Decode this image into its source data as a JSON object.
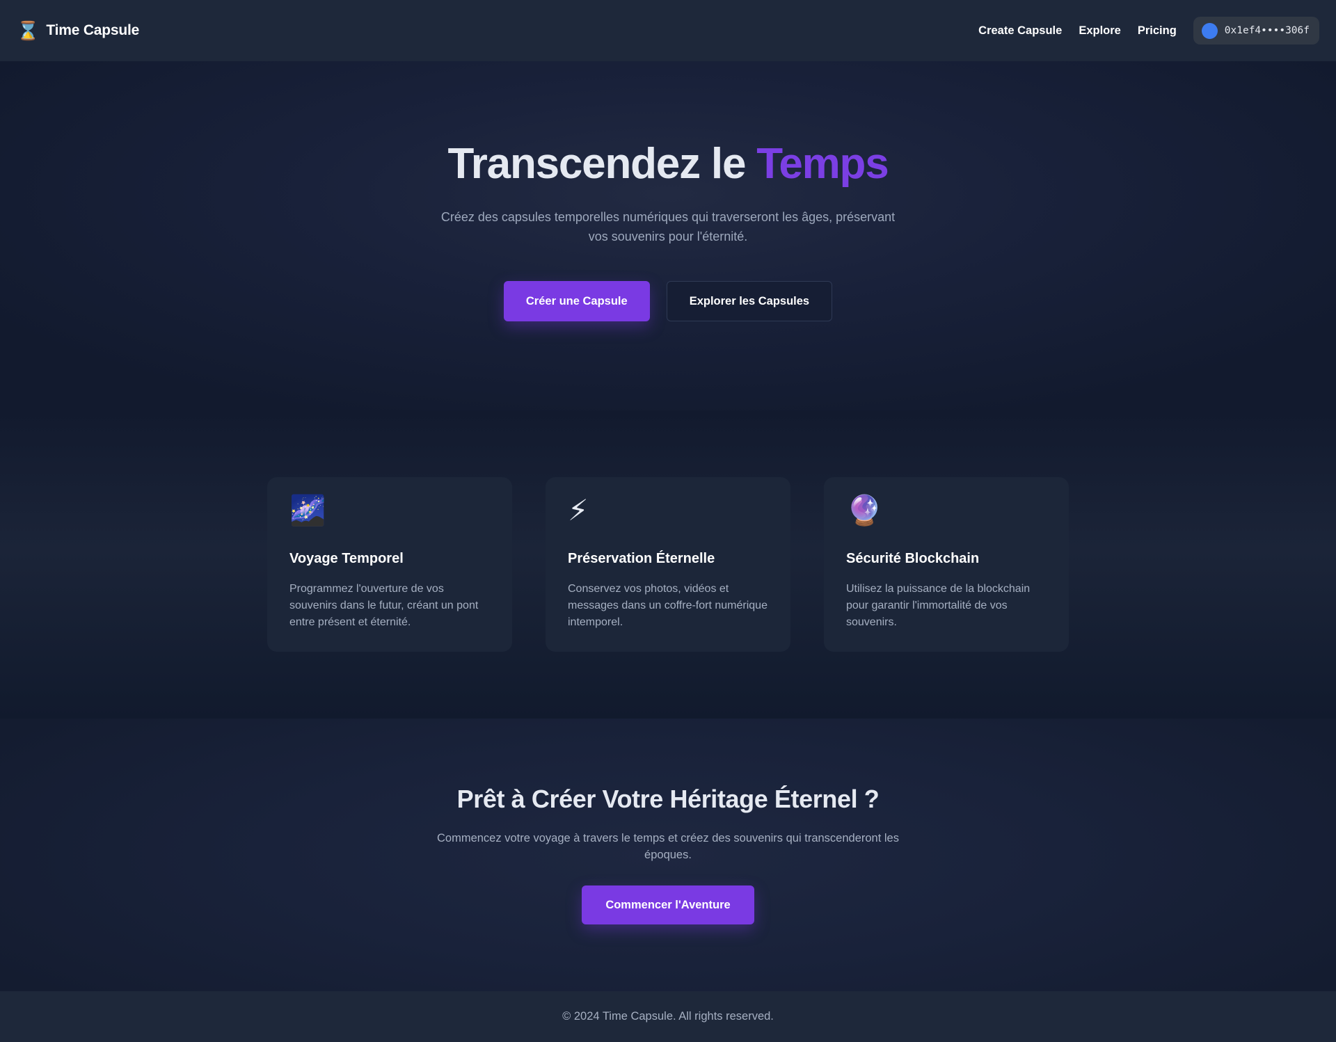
{
  "navbar": {
    "brand_icon": "⌛",
    "brand_title": "Time Capsule",
    "links": [
      "Create Capsule",
      "Explore",
      "Pricing"
    ],
    "wallet_address": "0x1ef4••••306f"
  },
  "hero": {
    "title_main": "Transcendez le",
    "title_accent": "Temps",
    "subtitle": "Créez des capsules temporelles numériques qui traverseront les âges, préservant vos souvenirs pour l'éternité.",
    "primary_button": "Créer une Capsule",
    "secondary_button": "Explorer les Capsules"
  },
  "features": [
    {
      "icon": "🌌",
      "icon_name": "milky-way-icon",
      "title": "Voyage Temporel",
      "description": "Programmez l'ouverture de vos souvenirs dans le futur, créant un pont entre présent et éternité."
    },
    {
      "icon": "⚡",
      "icon_name": "lightning-icon",
      "title": "Préservation Éternelle",
      "description": "Conservez vos photos, vidéos et messages dans un coffre-fort numérique intemporel."
    },
    {
      "icon": "🔮",
      "icon_name": "crystal-ball-icon",
      "title": "Sécurité Blockchain",
      "description": "Utilisez la puissance de la blockchain pour garantir l'immortalité de vos souvenirs."
    }
  ],
  "cta": {
    "title": "Prêt à Créer Votre Héritage Éternel ?",
    "subtitle": "Commencez votre voyage à travers le temps et créez des souvenirs qui transcenderont les époques.",
    "button": "Commencer l'Aventure"
  },
  "footer": {
    "copyright": "© 2024 Time Capsule. All rights reserved."
  },
  "colors": {
    "accent": "#7a3ae3",
    "title_accent": "#7b3fe4",
    "wallet_dot": "#3d7cf0",
    "nav_bg": "#1e283a",
    "card_bg": "#1c2639"
  }
}
